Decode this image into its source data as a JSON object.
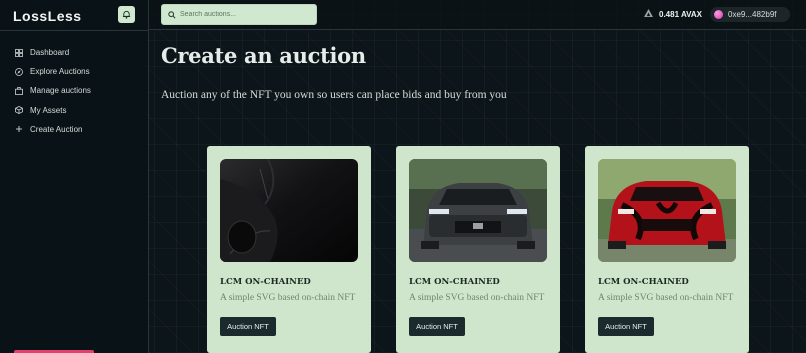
{
  "app": {
    "logo": "LossLess"
  },
  "sidebar": {
    "items": [
      {
        "label": "Dashboard",
        "icon": "grid-icon"
      },
      {
        "label": "Explore Auctions",
        "icon": "compass-icon"
      },
      {
        "label": "Manage auctions",
        "icon": "briefcase-icon"
      },
      {
        "label": "My Assets",
        "icon": "cube-icon"
      },
      {
        "label": "Create Auction",
        "icon": "plus-icon"
      }
    ]
  },
  "header": {
    "search_placeholder": "Search auctions...",
    "balance": "0.481 AVAX",
    "wallet_address": "0xe9...482b9f"
  },
  "main": {
    "title": "Create an auction",
    "subtitle": "Auction any of the NFT you own so users can place bids and buy from you",
    "cards": [
      {
        "name": "LCM ON-CHAINED",
        "description": "A simple SVG based on-chain NFT",
        "button": "Auction NFT",
        "image": "dark-car-closeup"
      },
      {
        "name": "LCM ON-CHAINED",
        "description": "A simple SVG based on-chain NFT",
        "button": "Auction NFT",
        "image": "grey-mustang-front"
      },
      {
        "name": "LCM ON-CHAINED",
        "description": "A simple SVG based on-chain NFT",
        "button": "Auction NFT",
        "image": "red-black-car-front"
      }
    ]
  },
  "colors": {
    "accent": "#cfe6cd",
    "button": "#1a2a2d",
    "background": "#0c1519",
    "wallet_dot": "#d13ab0"
  }
}
